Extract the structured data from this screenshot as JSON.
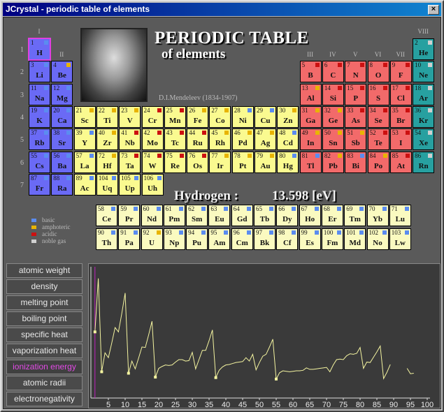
{
  "window": {
    "title": "JCrystal - periodic table of elements",
    "close_label": "×"
  },
  "header": {
    "title": "PERIODIC TABLE",
    "subtitle": "of elements",
    "author": "D.I.Mendeleev (1834-1907)"
  },
  "groups": [
    "I",
    "II",
    "III",
    "IV",
    "V",
    "VI",
    "VII",
    "VIII"
  ],
  "periods": [
    "1",
    "2",
    "3",
    "4",
    "5",
    "6",
    "7"
  ],
  "selected": {
    "name": "Hydrogen :",
    "value": "13.598 [eV]"
  },
  "legend": [
    {
      "label": "basic",
      "color": "#5b8cf0"
    },
    {
      "label": "amphoteric",
      "color": "#e8b400"
    },
    {
      "label": "acidic",
      "color": "#cc1010"
    },
    {
      "label": "noble gas",
      "color": "#d0d0d0"
    }
  ],
  "colors": {
    "s": "#6a6af5",
    "d": "#fafa90",
    "p": "#f26a6a",
    "noble": "#27a0a0",
    "f": "#fafac0"
  },
  "properties": [
    {
      "label": "atomic weight",
      "active": false
    },
    {
      "label": "density",
      "active": false
    },
    {
      "label": "melting point",
      "active": false
    },
    {
      "label": "boiling point",
      "active": false
    },
    {
      "label": "specific heat",
      "active": false
    },
    {
      "label": "vaporization heat",
      "active": false
    },
    {
      "label": "ionization energy",
      "active": true
    },
    {
      "label": "atomic radii",
      "active": false
    },
    {
      "label": "electronegativity",
      "active": false
    }
  ],
  "elements": [
    {
      "n": 1,
      "s": "H",
      "cat": "s",
      "ox": "basic"
    },
    {
      "n": 2,
      "s": "He",
      "cat": "noble",
      "ox": "noble"
    },
    {
      "n": 3,
      "s": "Li",
      "cat": "s",
      "ox": "basic"
    },
    {
      "n": 4,
      "s": "Be",
      "cat": "s",
      "ox": "amphoteric"
    },
    {
      "n": 5,
      "s": "B",
      "cat": "p",
      "ox": "acidic"
    },
    {
      "n": 6,
      "s": "C",
      "cat": "p",
      "ox": "acidic"
    },
    {
      "n": 7,
      "s": "N",
      "cat": "p",
      "ox": "acidic"
    },
    {
      "n": 8,
      "s": "O",
      "cat": "p",
      "ox": "acidic"
    },
    {
      "n": 9,
      "s": "F",
      "cat": "p",
      "ox": "acidic"
    },
    {
      "n": 10,
      "s": "Ne",
      "cat": "noble",
      "ox": "noble"
    },
    {
      "n": 11,
      "s": "Na",
      "cat": "s",
      "ox": "basic"
    },
    {
      "n": 12,
      "s": "Mg",
      "cat": "s",
      "ox": "basic"
    },
    {
      "n": 13,
      "s": "Al",
      "cat": "p",
      "ox": "amphoteric"
    },
    {
      "n": 14,
      "s": "Si",
      "cat": "p",
      "ox": "acidic"
    },
    {
      "n": 15,
      "s": "P",
      "cat": "p",
      "ox": "acidic"
    },
    {
      "n": 16,
      "s": "S",
      "cat": "p",
      "ox": "acidic"
    },
    {
      "n": 17,
      "s": "Cl",
      "cat": "p",
      "ox": "acidic"
    },
    {
      "n": 18,
      "s": "Ar",
      "cat": "noble",
      "ox": "noble"
    },
    {
      "n": 19,
      "s": "K",
      "cat": "s",
      "ox": "basic"
    },
    {
      "n": 20,
      "s": "Ca",
      "cat": "s",
      "ox": "basic"
    },
    {
      "n": 21,
      "s": "Sc",
      "cat": "d",
      "ox": "amphoteric"
    },
    {
      "n": 22,
      "s": "Ti",
      "cat": "d",
      "ox": "amphoteric"
    },
    {
      "n": 23,
      "s": "V",
      "cat": "d",
      "ox": "amphoteric"
    },
    {
      "n": 24,
      "s": "Cr",
      "cat": "d",
      "ox": "acidic"
    },
    {
      "n": 25,
      "s": "Mn",
      "cat": "d",
      "ox": "acidic"
    },
    {
      "n": 26,
      "s": "Fe",
      "cat": "d",
      "ox": "amphoteric"
    },
    {
      "n": 27,
      "s": "Co",
      "cat": "d",
      "ox": "amphoteric"
    },
    {
      "n": 28,
      "s": "Ni",
      "cat": "d",
      "ox": "basic"
    },
    {
      "n": 29,
      "s": "Cu",
      "cat": "d",
      "ox": "basic"
    },
    {
      "n": 30,
      "s": "Zn",
      "cat": "d",
      "ox": "amphoteric"
    },
    {
      "n": 31,
      "s": "Ga",
      "cat": "p",
      "ox": "amphoteric"
    },
    {
      "n": 32,
      "s": "Ge",
      "cat": "p",
      "ox": "amphoteric"
    },
    {
      "n": 33,
      "s": "As",
      "cat": "p",
      "ox": "acidic"
    },
    {
      "n": 34,
      "s": "Se",
      "cat": "p",
      "ox": "acidic"
    },
    {
      "n": 35,
      "s": "Br",
      "cat": "p",
      "ox": "acidic"
    },
    {
      "n": 36,
      "s": "Kr",
      "cat": "noble",
      "ox": "noble"
    },
    {
      "n": 37,
      "s": "Rb",
      "cat": "s",
      "ox": "basic"
    },
    {
      "n": 38,
      "s": "Sr",
      "cat": "s",
      "ox": "basic"
    },
    {
      "n": 39,
      "s": "Y",
      "cat": "d",
      "ox": "basic"
    },
    {
      "n": 40,
      "s": "Zr",
      "cat": "d",
      "ox": "amphoteric"
    },
    {
      "n": 41,
      "s": "Nb",
      "cat": "d",
      "ox": "acidic"
    },
    {
      "n": 42,
      "s": "Mo",
      "cat": "d",
      "ox": "acidic"
    },
    {
      "n": 43,
      "s": "Tc",
      "cat": "d",
      "ox": "acidic"
    },
    {
      "n": 44,
      "s": "Ru",
      "cat": "d",
      "ox": "acidic"
    },
    {
      "n": 45,
      "s": "Rh",
      "cat": "d",
      "ox": "amphoteric"
    },
    {
      "n": 46,
      "s": "Pd",
      "cat": "d",
      "ox": "amphoteric"
    },
    {
      "n": 47,
      "s": "Ag",
      "cat": "d",
      "ox": "amphoteric"
    },
    {
      "n": 48,
      "s": "Cd",
      "cat": "d",
      "ox": "basic"
    },
    {
      "n": 49,
      "s": "In",
      "cat": "p",
      "ox": "amphoteric"
    },
    {
      "n": 50,
      "s": "Sn",
      "cat": "p",
      "ox": "amphoteric"
    },
    {
      "n": 51,
      "s": "Sb",
      "cat": "p",
      "ox": "amphoteric"
    },
    {
      "n": 52,
      "s": "Te",
      "cat": "p",
      "ox": "acidic"
    },
    {
      "n": 53,
      "s": "I",
      "cat": "p",
      "ox": "acidic"
    },
    {
      "n": 54,
      "s": "Xe",
      "cat": "noble",
      "ox": "noble"
    },
    {
      "n": 55,
      "s": "Cs",
      "cat": "s",
      "ox": "basic"
    },
    {
      "n": 56,
      "s": "Ba",
      "cat": "s",
      "ox": "basic"
    },
    {
      "n": 57,
      "s": "La",
      "cat": "d",
      "ox": "basic"
    },
    {
      "n": 72,
      "s": "Hf",
      "cat": "d",
      "ox": "amphoteric"
    },
    {
      "n": 73,
      "s": "Ta",
      "cat": "d",
      "ox": "acidic"
    },
    {
      "n": 74,
      "s": "W",
      "cat": "d",
      "ox": "acidic"
    },
    {
      "n": 75,
      "s": "Re",
      "cat": "d",
      "ox": "acidic"
    },
    {
      "n": 76,
      "s": "Os",
      "cat": "d",
      "ox": "acidic"
    },
    {
      "n": 77,
      "s": "Ir",
      "cat": "d",
      "ox": "amphoteric"
    },
    {
      "n": 78,
      "s": "Pt",
      "cat": "d",
      "ox": "amphoteric"
    },
    {
      "n": 79,
      "s": "Au",
      "cat": "d",
      "ox": "amphoteric"
    },
    {
      "n": 80,
      "s": "Hg",
      "cat": "d",
      "ox": "basic"
    },
    {
      "n": 81,
      "s": "Tl",
      "cat": "p",
      "ox": "basic"
    },
    {
      "n": 82,
      "s": "Pb",
      "cat": "p",
      "ox": "amphoteric"
    },
    {
      "n": 83,
      "s": "Bi",
      "cat": "p",
      "ox": "basic"
    },
    {
      "n": 84,
      "s": "Po",
      "cat": "p",
      "ox": "amphoteric"
    },
    {
      "n": 85,
      "s": "At",
      "cat": "p",
      "ox": "acidic"
    },
    {
      "n": 86,
      "s": "Rn",
      "cat": "noble",
      "ox": "noble"
    },
    {
      "n": 87,
      "s": "Fr",
      "cat": "s",
      "ox": "basic"
    },
    {
      "n": 88,
      "s": "Ra",
      "cat": "s",
      "ox": "basic"
    },
    {
      "n": 89,
      "s": "Ac",
      "cat": "d",
      "ox": "basic"
    },
    {
      "n": 104,
      "s": "Uq",
      "cat": "d",
      "ox": "basic"
    },
    {
      "n": 105,
      "s": "Up",
      "cat": "d",
      "ox": "basic"
    },
    {
      "n": 106,
      "s": "Uh",
      "cat": "d",
      "ox": "basic"
    },
    {
      "n": 58,
      "s": "Ce",
      "cat": "f",
      "ox": "basic"
    },
    {
      "n": 59,
      "s": "Pr",
      "cat": "f",
      "ox": "basic"
    },
    {
      "n": 60,
      "s": "Nd",
      "cat": "f",
      "ox": "basic"
    },
    {
      "n": 61,
      "s": "Pm",
      "cat": "f",
      "ox": "basic"
    },
    {
      "n": 62,
      "s": "Sm",
      "cat": "f",
      "ox": "basic"
    },
    {
      "n": 63,
      "s": "Eu",
      "cat": "f",
      "ox": "basic"
    },
    {
      "n": 64,
      "s": "Gd",
      "cat": "f",
      "ox": "basic"
    },
    {
      "n": 65,
      "s": "Tb",
      "cat": "f",
      "ox": "basic"
    },
    {
      "n": 66,
      "s": "Dy",
      "cat": "f",
      "ox": "basic"
    },
    {
      "n": 67,
      "s": "Ho",
      "cat": "f",
      "ox": "basic"
    },
    {
      "n": 68,
      "s": "Er",
      "cat": "f",
      "ox": "basic"
    },
    {
      "n": 69,
      "s": "Tm",
      "cat": "f",
      "ox": "basic"
    },
    {
      "n": 70,
      "s": "Yb",
      "cat": "f",
      "ox": "basic"
    },
    {
      "n": 71,
      "s": "Lu",
      "cat": "f",
      "ox": "basic"
    },
    {
      "n": 90,
      "s": "Th",
      "cat": "f",
      "ox": "basic"
    },
    {
      "n": 91,
      "s": "Pa",
      "cat": "f",
      "ox": "basic"
    },
    {
      "n": 92,
      "s": "U",
      "cat": "f",
      "ox": "amphoteric"
    },
    {
      "n": 93,
      "s": "Np",
      "cat": "f",
      "ox": "basic"
    },
    {
      "n": 94,
      "s": "Pu",
      "cat": "f",
      "ox": "basic"
    },
    {
      "n": 95,
      "s": "Am",
      "cat": "f",
      "ox": "basic"
    },
    {
      "n": 96,
      "s": "Cm",
      "cat": "f",
      "ox": "basic"
    },
    {
      "n": 97,
      "s": "Bk",
      "cat": "f",
      "ox": "basic"
    },
    {
      "n": 98,
      "s": "Cf",
      "cat": "f",
      "ox": "basic"
    },
    {
      "n": 99,
      "s": "Es",
      "cat": "f",
      "ox": "basic"
    },
    {
      "n": 100,
      "s": "Fm",
      "cat": "f",
      "ox": "basic"
    },
    {
      "n": 101,
      "s": "Md",
      "cat": "f",
      "ox": "basic"
    },
    {
      "n": 102,
      "s": "No",
      "cat": "f",
      "ox": "basic"
    },
    {
      "n": 103,
      "s": "Lw",
      "cat": "f",
      "ox": "basic"
    }
  ],
  "chart_data": {
    "type": "line",
    "xlabel": "",
    "ylabel": "",
    "xlim": [
      0,
      100
    ],
    "xticks": [
      5,
      10,
      15,
      20,
      25,
      30,
      35,
      40,
      45,
      50,
      55,
      60,
      65,
      70,
      75,
      80,
      85,
      90,
      95,
      100
    ],
    "highlight_x": 1,
    "ylim": [
      0,
      27
    ],
    "markers_x": [
      1,
      3,
      11,
      19,
      37,
      55
    ],
    "series": [
      {
        "values": [
          [
            1,
            13.6
          ],
          [
            2,
            24.6
          ],
          [
            3,
            5.4
          ],
          [
            4,
            9.3
          ],
          [
            5,
            8.3
          ],
          [
            6,
            11.3
          ],
          [
            7,
            14.5
          ],
          [
            8,
            13.6
          ],
          [
            9,
            17.4
          ],
          [
            10,
            21.6
          ],
          [
            11,
            5.1
          ],
          [
            12,
            7.6
          ],
          [
            13,
            6.0
          ],
          [
            14,
            8.2
          ],
          [
            15,
            10.5
          ],
          [
            16,
            10.4
          ],
          [
            17,
            13.0
          ],
          [
            18,
            15.8
          ],
          [
            19,
            4.3
          ],
          [
            20,
            6.1
          ],
          [
            21,
            6.5
          ],
          [
            22,
            6.8
          ],
          [
            23,
            6.7
          ],
          [
            24,
            6.8
          ],
          [
            25,
            7.4
          ],
          [
            26,
            7.9
          ],
          [
            27,
            7.9
          ],
          [
            28,
            7.6
          ],
          [
            29,
            7.7
          ],
          [
            30,
            9.4
          ],
          [
            31,
            6.0
          ],
          [
            32,
            7.9
          ],
          [
            33,
            9.8
          ],
          [
            34,
            9.8
          ],
          [
            35,
            11.8
          ],
          [
            36,
            14.0
          ],
          [
            37,
            4.2
          ],
          [
            38,
            5.7
          ],
          [
            39,
            6.4
          ],
          [
            40,
            6.8
          ],
          [
            41,
            6.9
          ],
          [
            42,
            7.1
          ],
          [
            43,
            7.3
          ],
          [
            44,
            7.4
          ],
          [
            45,
            7.5
          ],
          [
            46,
            8.3
          ],
          [
            47,
            7.6
          ],
          [
            48,
            9.0
          ],
          [
            49,
            5.8
          ],
          [
            50,
            7.3
          ],
          [
            51,
            8.6
          ],
          [
            52,
            9.0
          ],
          [
            53,
            10.5
          ],
          [
            54,
            12.1
          ],
          [
            55,
            3.9
          ],
          [
            56,
            5.2
          ],
          [
            57,
            5.6
          ],
          [
            58,
            5.5
          ],
          [
            59,
            5.4
          ],
          [
            60,
            5.5
          ],
          [
            61,
            5.6
          ],
          [
            62,
            5.6
          ],
          [
            63,
            5.7
          ],
          [
            64,
            6.2
          ],
          [
            65,
            5.9
          ],
          [
            66,
            5.9
          ],
          [
            67,
            6.0
          ],
          [
            68,
            6.1
          ],
          [
            69,
            6.2
          ],
          [
            70,
            6.3
          ],
          [
            71,
            5.4
          ],
          [
            72,
            6.8
          ],
          [
            73,
            7.9
          ],
          [
            74,
            8.0
          ],
          [
            75,
            7.9
          ],
          [
            76,
            8.7
          ],
          [
            77,
            9.1
          ],
          [
            78,
            9.0
          ],
          [
            79,
            9.2
          ],
          [
            80,
            10.4
          ],
          [
            81,
            6.1
          ],
          [
            82,
            7.4
          ],
          [
            83,
            7.3
          ],
          [
            84,
            8.4
          ],
          [
            85,
            9.5
          ],
          [
            86,
            10.7
          ],
          [
            87,
            4.0
          ],
          [
            88,
            5.3
          ],
          [
            89,
            6.9
          ],
          [
            90,
            null
          ],
          [
            91,
            null
          ],
          [
            92,
            null
          ],
          [
            93,
            null
          ],
          [
            94,
            6.1
          ],
          [
            95,
            5.0
          ],
          [
            96,
            5.1
          ]
        ]
      }
    ]
  }
}
